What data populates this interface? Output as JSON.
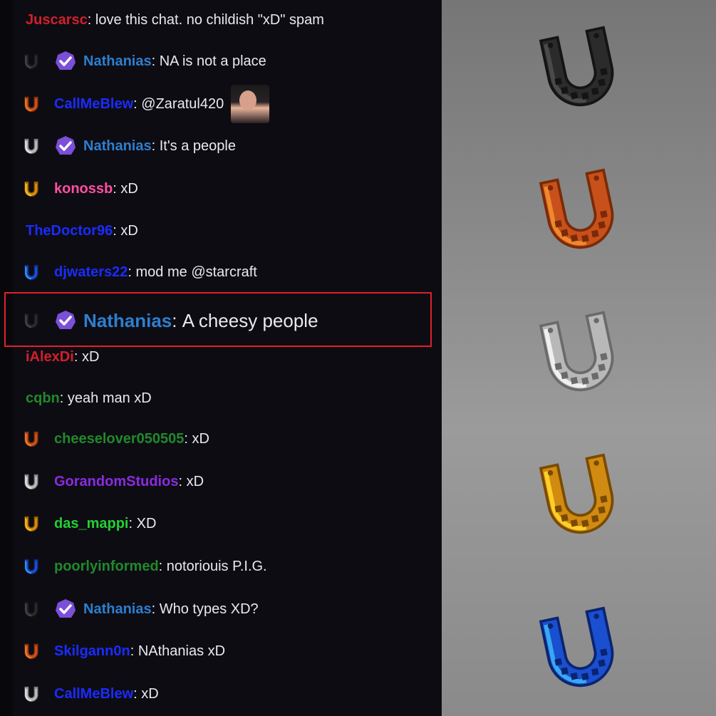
{
  "chat": {
    "messages": [
      {
        "user": "Juscarsc",
        "text": "love this chat. no childish \"xD\" spam",
        "color": "#d0202a",
        "shoe": null,
        "badge": false
      },
      {
        "user": "Nathanias",
        "text": "NA is not a place",
        "color": "#2d7fd0",
        "shoe": "black",
        "badge": true
      },
      {
        "user": "CallMeBlew",
        "text": "@Zaratul420",
        "color": "#1a2cff",
        "shoe": "orange",
        "badge": false,
        "emote": true
      },
      {
        "user": "Nathanias",
        "text": "It's a people",
        "color": "#2d7fd0",
        "shoe": "silver",
        "badge": true
      },
      {
        "user": "konossb",
        "text": "xD",
        "color": "#ff4fa3",
        "shoe": "gold",
        "badge": false
      },
      {
        "user": "TheDoctor96",
        "text": "xD",
        "color": "#1a2cff",
        "shoe": null,
        "badge": false
      },
      {
        "user": "djwaters22",
        "text": "mod me @starcraft",
        "color": "#1a2cff",
        "shoe": "blue",
        "badge": false
      },
      {
        "user": "Nathanias",
        "text": "A cheesy people",
        "color": "#2d7fd0",
        "shoe": "black",
        "badge": true,
        "big": true
      },
      {
        "user": "iAlexDi",
        "text": "xD",
        "color": "#d0202a",
        "shoe": null,
        "badge": false
      },
      {
        "user": "cqbn",
        "text": "yeah man xD",
        "color": "#1f8a2a",
        "shoe": null,
        "badge": false
      },
      {
        "user": "cheeselover050505",
        "text": "xD",
        "color": "#1f8a2a",
        "shoe": "orange",
        "badge": false
      },
      {
        "user": "GorandomStudios",
        "text": "xD",
        "color": "#8a2be2",
        "shoe": "silver",
        "badge": false
      },
      {
        "user": "das_mappi",
        "text": "XD",
        "color": "#22d033",
        "shoe": "gold",
        "badge": false
      },
      {
        "user": "poorlyinformed",
        "text": "notoriouis P.I.G.",
        "color": "#1f8a2a",
        "shoe": "blue",
        "badge": false
      },
      {
        "user": "Nathanias",
        "text": "Who types XD?",
        "color": "#2d7fd0",
        "shoe": "black",
        "badge": true
      },
      {
        "user": "Skilgann0n",
        "text": "NAthanias xD",
        "color": "#1a2cff",
        "shoe": "orange",
        "badge": false
      },
      {
        "user": "CallMeBlew",
        "text": "xD",
        "color": "#1a2cff",
        "shoe": "silver",
        "badge": false
      }
    ]
  },
  "panel": {
    "horseshoes": [
      "black",
      "orange",
      "silver",
      "gold",
      "blue"
    ]
  },
  "colors": {
    "black": [
      "#2b2b2b",
      "#4a4a4a",
      "#141414"
    ],
    "orange": [
      "#c8501a",
      "#f0892e",
      "#7a2a08"
    ],
    "silver": [
      "#b8b8b8",
      "#f0f0f0",
      "#6a6a6a"
    ],
    "gold": [
      "#d08b10",
      "#ffd028",
      "#7a4a04"
    ],
    "blue": [
      "#1a4fd0",
      "#3aa8f0",
      "#0a2470"
    ],
    "badge": "#7b4fd8"
  }
}
